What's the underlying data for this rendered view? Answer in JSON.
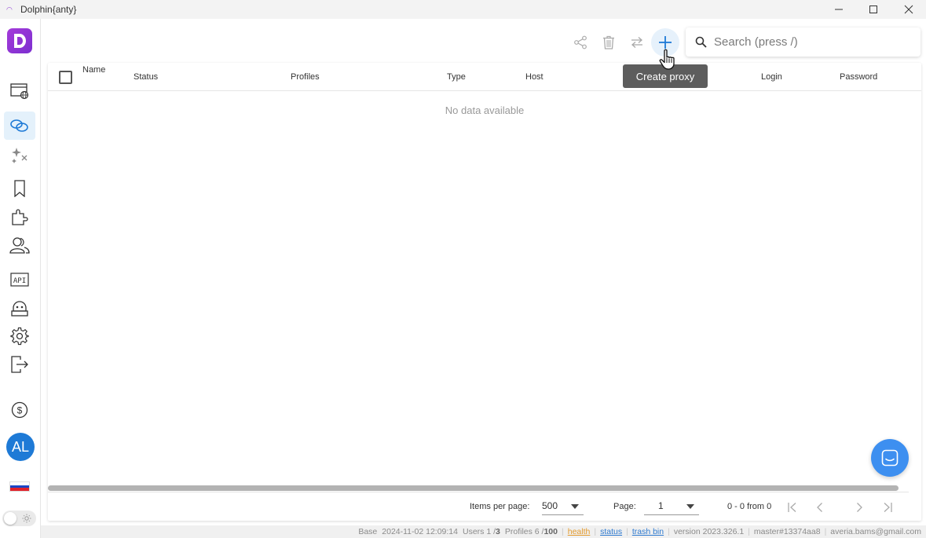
{
  "window": {
    "title": "Dolphin{anty}"
  },
  "sidebar": {
    "avatar_initials": "AL",
    "items": [
      {
        "name": "browser-profiles-icon"
      },
      {
        "name": "proxy-icon",
        "active": true
      },
      {
        "name": "automation-icon"
      },
      {
        "name": "bookmarks-icon"
      },
      {
        "name": "extensions-icon"
      },
      {
        "name": "users-icon"
      },
      {
        "name": "api-icon"
      },
      {
        "name": "robot-icon"
      },
      {
        "name": "settings-icon"
      },
      {
        "name": "logout-icon"
      },
      {
        "name": "billing-icon"
      }
    ]
  },
  "toolbar": {
    "search_placeholder": "Search (press /)",
    "tooltip": "Create proxy"
  },
  "table": {
    "columns": [
      "Name",
      "Status",
      "Profiles",
      "Type",
      "Host",
      "Login",
      "Password"
    ],
    "empty_text": "No data available"
  },
  "pagination": {
    "items_per_page_label": "Items per page:",
    "items_per_page_value": "500",
    "page_label": "Page:",
    "page_value": "1",
    "range_text": "0 - 0 from 0"
  },
  "statusbar": {
    "base": "Base",
    "datetime": "2024-11-02 12:09:14",
    "users_label": "Users 1 / ",
    "users_max": "3",
    "profiles_label": "Profiles 6 / ",
    "profiles_max": "100",
    "health": "health",
    "status": "status",
    "trash": "trash bin",
    "version": "version 2023.326.1",
    "build": "master#13374aa8",
    "email": "averia.bams@gmail.com"
  },
  "colors": {
    "accent": "#1e7ad6",
    "logo": "#8f3fd6",
    "tooltip_bg": "#5d5d5d",
    "chat": "#3d8ff0",
    "health": "#e39a2d"
  }
}
